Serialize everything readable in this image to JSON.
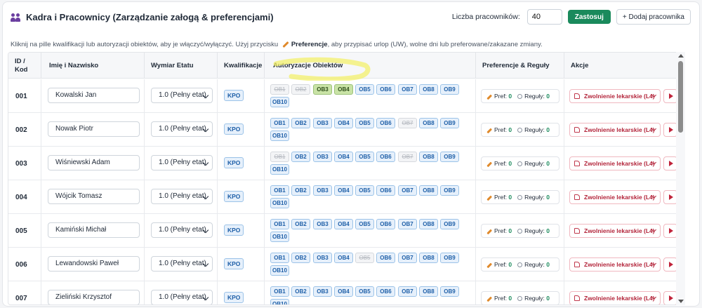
{
  "header": {
    "title": "Kadra i Pracownicy (Zarządzanie załogą & preferencjami)",
    "count_label": "Liczba pracowników:",
    "count_value": "40",
    "apply_label": "Zastosuj",
    "add_label": "+ Dodaj pracownika"
  },
  "info": {
    "text_before": "Kliknij na pille kwalifikacji lub autoryzacji obiektów, aby je włączyć/wyłączyć. Użyj przycisku",
    "bold": "Preferencje",
    "text_after": ", aby przypisać urlop (UW), wolne dni lub preferowane/zakazane zmiany."
  },
  "columns": {
    "id": "ID / Kod",
    "name": "Imię i Nazwisko",
    "etat": "Wymiar Etatu",
    "kwal": "Kwalifikacje",
    "auth": "Autoryzacje Obiektów",
    "pref": "Preferencje & Reguły",
    "akcje": "Akcje"
  },
  "objects": [
    "OB1",
    "OB2",
    "OB3",
    "OB4",
    "OB5",
    "OB6",
    "OB7",
    "OB8",
    "OB9",
    "OB10"
  ],
  "colors": {
    "accent_green": "#1a8a5c",
    "active_pill": "#e6f0fb",
    "selected_pill": "#c9e3a6",
    "danger": "#b3243a",
    "highlight": "#f3f06b"
  },
  "labels": {
    "pref": "Pref:",
    "rules": "Reguły:",
    "action": "Zwolnienie lekarskie (L4)"
  },
  "employees": [
    {
      "id": "001",
      "name": "Kowalski Jan",
      "etat": "1.0 (Pełny etat)",
      "kwal": "KPO",
      "pref": "0",
      "rules": "0",
      "states": [
        "off",
        "off",
        "on",
        "on",
        "active",
        "active",
        "active",
        "active",
        "active",
        "active"
      ]
    },
    {
      "id": "002",
      "name": "Nowak Piotr",
      "etat": "1.0 (Pełny etat)",
      "kwal": "KPO",
      "pref": "0",
      "rules": "0",
      "states": [
        "active",
        "active",
        "active",
        "active",
        "active",
        "active",
        "off",
        "active",
        "active",
        "active"
      ]
    },
    {
      "id": "003",
      "name": "Wiśniewski Adam",
      "etat": "1.0 (Pełny etat)",
      "kwal": "KPO",
      "pref": "0",
      "rules": "0",
      "states": [
        "off",
        "active",
        "active",
        "active",
        "active",
        "active",
        "off",
        "active",
        "active",
        "active"
      ]
    },
    {
      "id": "004",
      "name": "Wójcik Tomasz",
      "etat": "1.0 (Pełny etat)",
      "kwal": "KPO",
      "pref": "0",
      "rules": "0",
      "states": [
        "active",
        "active",
        "active",
        "active",
        "active",
        "active",
        "active",
        "active",
        "active",
        "active"
      ]
    },
    {
      "id": "005",
      "name": "Kamiński Michał",
      "etat": "1.0 (Pełny etat)",
      "kwal": "KPO",
      "pref": "0",
      "rules": "0",
      "states": [
        "active",
        "active",
        "active",
        "active",
        "active",
        "active",
        "active",
        "active",
        "active",
        "active"
      ]
    },
    {
      "id": "006",
      "name": "Lewandowski Paweł",
      "etat": "1.0 (Pełny etat)",
      "kwal": "KPO",
      "pref": "0",
      "rules": "0",
      "states": [
        "active",
        "active",
        "active",
        "active",
        "off",
        "active",
        "active",
        "active",
        "active",
        "active"
      ]
    },
    {
      "id": "007",
      "name": "Zieliński Krzysztof",
      "etat": "1.0 (Pełny etat)",
      "kwal": "KPO",
      "pref": "0",
      "rules": "0",
      "states": [
        "active",
        "active",
        "active",
        "active",
        "active",
        "active",
        "active",
        "active",
        "active",
        "active"
      ]
    }
  ]
}
